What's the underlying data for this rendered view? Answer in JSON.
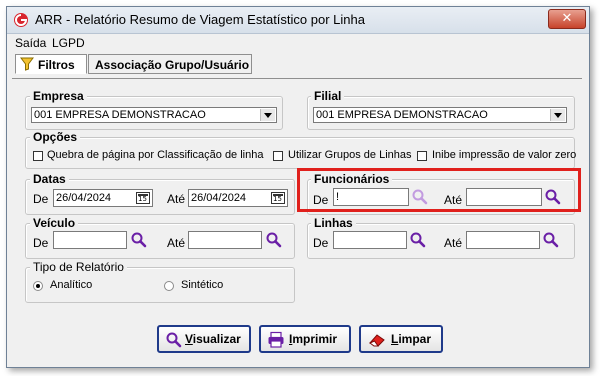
{
  "window": {
    "title": "ARR - Relatório Resumo de Viagem Estatístico por Linha",
    "close_label": "✕"
  },
  "menu": {
    "items": [
      "Saída",
      "LGPD"
    ]
  },
  "tabs": [
    {
      "label": "Filtros",
      "active": true
    },
    {
      "label": "Associação Grupo/Usuário",
      "active": false
    }
  ],
  "empresa": {
    "legend": "Empresa",
    "value": "001 EMPRESA DEMONSTRACAO"
  },
  "filial": {
    "legend": "Filial",
    "value": "001 EMPRESA DEMONSTRACAO"
  },
  "opcoes": {
    "legend": "Opções",
    "checkboxes": [
      {
        "label": "Quebra de página por Classificação de linha",
        "checked": false
      },
      {
        "label": "Utilizar Grupos de Linhas",
        "checked": false
      },
      {
        "label": "Inibe impressão de valor zero",
        "checked": false
      }
    ]
  },
  "datas": {
    "legend": "Datas",
    "from_label": "De",
    "from_value": "26/04/2024",
    "to_label": "Até",
    "to_value": "26/04/2024",
    "cal_glyph": "15"
  },
  "funcionarios": {
    "legend": "Funcionários",
    "from_label": "De",
    "from_value": "!",
    "to_label": "Até",
    "to_value": ""
  },
  "veiculo": {
    "legend": "Veículo",
    "from_label": "De",
    "from_value": "",
    "to_label": "Até",
    "to_value": ""
  },
  "linhas": {
    "legend": "Linhas",
    "from_label": "De",
    "from_value": "",
    "to_label": "Até",
    "to_value": ""
  },
  "tipo_relatorio": {
    "legend": "Tipo de Relatório",
    "options": [
      {
        "label": "Analítico",
        "selected": true
      },
      {
        "label": "Sintético",
        "selected": false
      }
    ]
  },
  "buttons": {
    "visualizar": {
      "first": "V",
      "rest": "isualizar"
    },
    "imprimir": {
      "first": "I",
      "rest": "mprimir"
    },
    "limpar": {
      "first": "L",
      "rest": "impar"
    }
  },
  "colors": {
    "highlight": "#e0201c",
    "accent_button_border": "#1f3a8a",
    "magnifier": "#6a1fa6",
    "magnifier_disabled": "#c29be0"
  }
}
